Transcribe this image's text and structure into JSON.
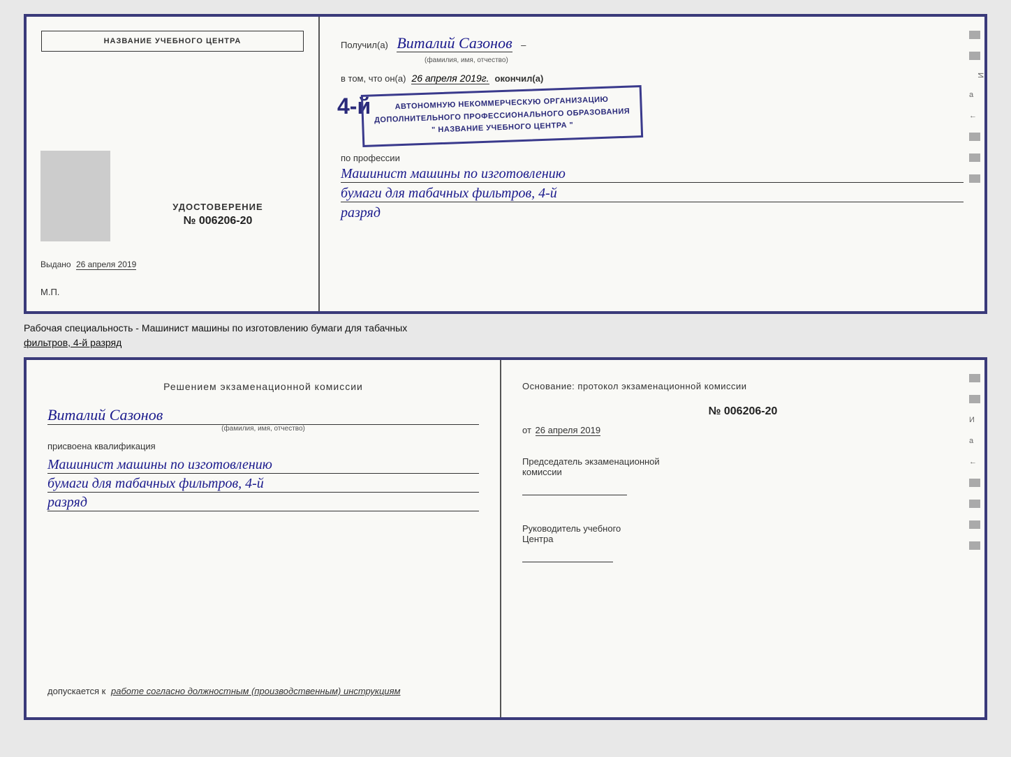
{
  "top_cert": {
    "left": {
      "org_name": "НАЗВАНИЕ УЧЕБНОГО ЦЕНТРА",
      "udost_label": "УДОСТОВЕРЕНИЕ",
      "udost_number": "№ 006206-20",
      "vydano_label": "Выдано",
      "vydano_date": "26 апреля 2019",
      "mp_label": "М.П."
    },
    "right": {
      "poluchil_prefix": "Получил(а)",
      "recipient_name": "Виталий Сазонов",
      "fio_hint": "(фамилия, имя, отчество)",
      "vtom_prefix": "в том, что он(а)",
      "vtom_date": "26 апреля 2019г.",
      "okoncil_label": "окончил(а)",
      "stamp_number": "4-й",
      "stamp_line1": "АВТОНОМНУЮ НЕКОММЕРЧЕСКУЮ ОРГАНИЗАЦИЮ",
      "stamp_line2": "ДОПОЛНИТЕЛЬНОГО ПРОФЕССИОНАЛЬНОГО ОБРАЗОВАНИЯ",
      "stamp_line3": "\" НАЗВАНИЕ УЧЕБНОГО ЦЕНТРА \"",
      "proprofessii": "по профессии",
      "prof_line1": "Машинист машины по изготовлению",
      "prof_line2": "бумаги для табачных фильтров, 4-й",
      "prof_line3": "разряд"
    }
  },
  "between_label": {
    "prefix": "Рабочая специальность - Машинист машины по изготовлению бумаги для табачных",
    "underline": "фильтров, 4-й разряд"
  },
  "bottom_cert": {
    "left": {
      "resheniem": "Решением экзаменационной комиссии",
      "name": "Виталий Сазонов",
      "fio_hint": "(фамилия, имя, отчество)",
      "prisvoena": "присвоена квалификация",
      "kvalif_line1": "Машинист машины по изготовлению",
      "kvalif_line2": "бумаги для табачных фильтров, 4-й",
      "kvalif_line3": "разряд",
      "dopuskaetsya_prefix": "допускается к",
      "dopuskaetsya_italic": "работе согласно должностным (производственным) инструкциям"
    },
    "right": {
      "osnovanie": "Основание: протокол экзаменационной комиссии",
      "prot_number": "№ 006206-20",
      "ot_prefix": "от",
      "ot_date": "26 апреля 2019",
      "predsedatel_line1": "Председатель экзаменационной",
      "predsedatel_line2": "комиссии",
      "rukovod_line1": "Руководитель учебного",
      "rukovod_line2": "Центра"
    }
  },
  "side_labels": {
    "И": "И",
    "а": "а",
    "стрелка": "←"
  }
}
